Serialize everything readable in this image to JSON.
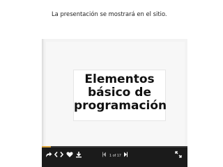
{
  "caption": "La presentación se mostrará en el sitio.",
  "slide": {
    "title_line1": "Elementos",
    "title_line2": "básico de",
    "title_line3": "programación"
  },
  "toolbar": {
    "page_indicator": "1 of 17",
    "progress_fraction": 0.06,
    "icons": [
      "share-icon",
      "embed-icon",
      "like-icon",
      "download-icon",
      "previous-slide-icon",
      "next-slide-icon",
      "fullscreen-icon"
    ]
  }
}
